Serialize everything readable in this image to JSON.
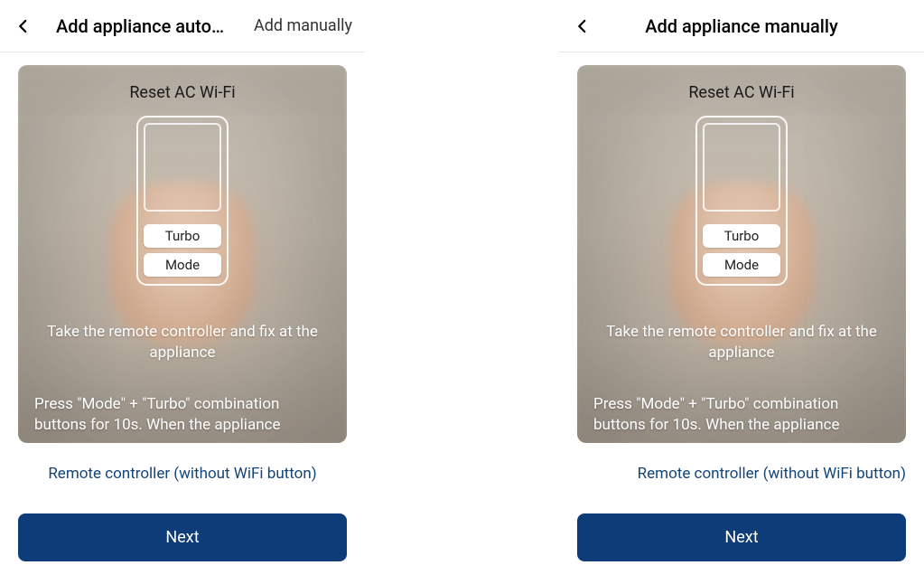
{
  "left": {
    "header_title": "Add appliance auto…",
    "header_action": "Add manually",
    "card": {
      "title": "Reset AC Wi-Fi",
      "remote_btn1": "Turbo",
      "remote_btn2": "Mode",
      "instruction_line1": "Take the remote controller and fix at the appliance",
      "instruction_line2": "Press \"Mode\" + \"Turbo\" combination buttons for 10s. When the appliance"
    },
    "link_label": "Remote controller (without WiFi button)",
    "primary_btn": "Next"
  },
  "right": {
    "header_title": "Add appliance manually",
    "card": {
      "title": "Reset AC Wi-Fi",
      "remote_btn1": "Turbo",
      "remote_btn2": "Mode",
      "instruction_line1": "Take the remote controller and fix at the appliance",
      "instruction_line2": "Press \"Mode\" + \"Turbo\" combination buttons for 10s. When the appliance"
    },
    "link_label": "Remote controller (without WiFi button)",
    "primary_btn": "Next"
  },
  "colors": {
    "primary": "#0d3c78",
    "link": "#12457a"
  }
}
